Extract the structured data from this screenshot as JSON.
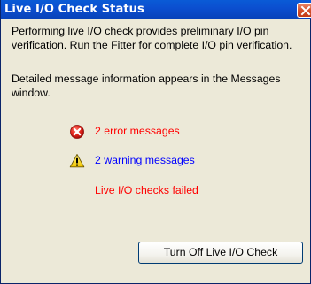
{
  "window": {
    "title": "Live I/O Check Status"
  },
  "content": {
    "paragraph1": "Performing live I/O check provides preliminary I/O pin verification. Run the Fitter for complete I/O pin verification.",
    "paragraph2": "Detailed message information appears in the Messages window.",
    "errors": {
      "icon": "error-icon",
      "text": "2 error messages",
      "color": "#ff0000"
    },
    "warnings": {
      "icon": "warning-icon",
      "text": "2 warning messages",
      "color": "#0000ff"
    },
    "status": {
      "text": "Live I/O checks failed",
      "color": "#ff0000"
    }
  },
  "buttons": {
    "turn_off_label": "Turn Off Live I/O Check"
  },
  "colors": {
    "titlebar": "#0842b8",
    "window_bg": "#ece9d8",
    "close_button": "#d4502c"
  }
}
